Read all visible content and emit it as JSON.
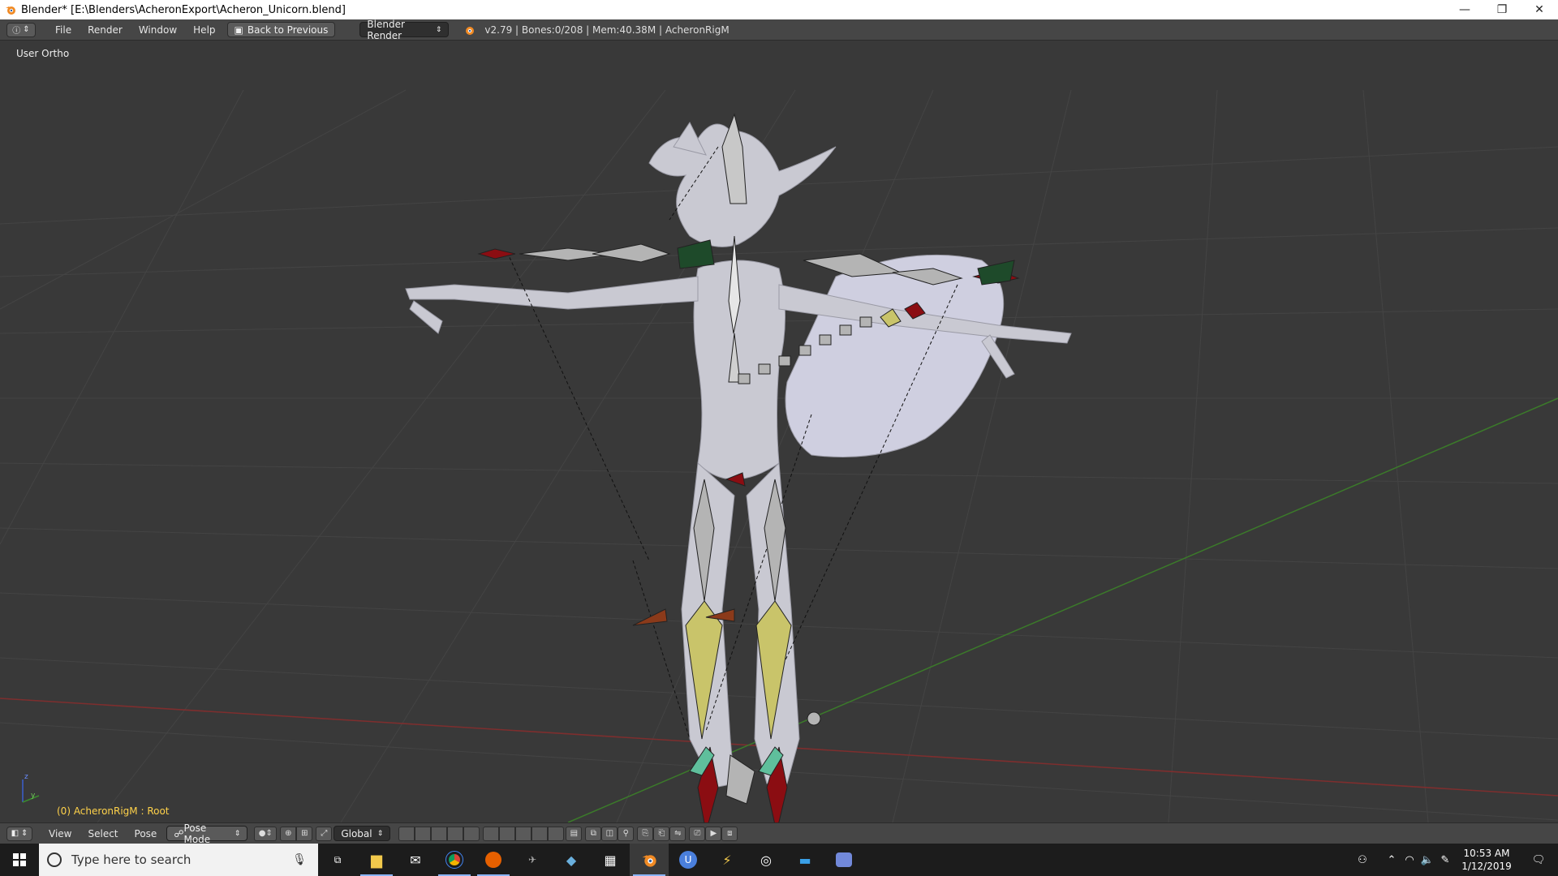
{
  "window": {
    "title": "Blender* [E:\\Blenders\\AcheronExport\\Acheron_Unicorn.blend]",
    "controls": {
      "minimize": "—",
      "restore": "❐",
      "close": "✕"
    }
  },
  "info_header": {
    "menus": [
      "File",
      "Render",
      "Window",
      "Help"
    ],
    "back_button": "Back to Previous",
    "render_engine": "Blender Render",
    "stats": "v2.79 | Bones:0/208 | Mem:40.38M | AcheronRigM"
  },
  "viewport": {
    "view_label": "User Ortho",
    "object_info": "(0) AcheronRigM : Root",
    "axis_labels": {
      "y": "y",
      "z": "z"
    }
  },
  "view_header": {
    "menus": [
      "View",
      "Select",
      "Pose"
    ],
    "mode": "Pose Mode",
    "orientation": "Global"
  },
  "taskbar": {
    "search_placeholder": "Type here to search",
    "time": "10:53 AM",
    "date": "1/12/2019",
    "apps": [
      "task-view",
      "file-explorer",
      "mail",
      "chrome",
      "firefox",
      "game",
      "sketchup",
      "calculator",
      "blender",
      "app-u",
      "thunder",
      "steam-like",
      "monitor",
      "discord"
    ]
  },
  "colors": {
    "viewport_bg": "#393939",
    "header_bg": "#464646",
    "bone_grey": "#b4b4b4",
    "bone_yellow": "#c9c46a",
    "bone_red": "#8b0d12",
    "bone_green": "#1e4a2a",
    "bone_teal": "#5fbf9c",
    "x_axis": "#8a2e2e",
    "y_axis": "#3f8a2e"
  }
}
